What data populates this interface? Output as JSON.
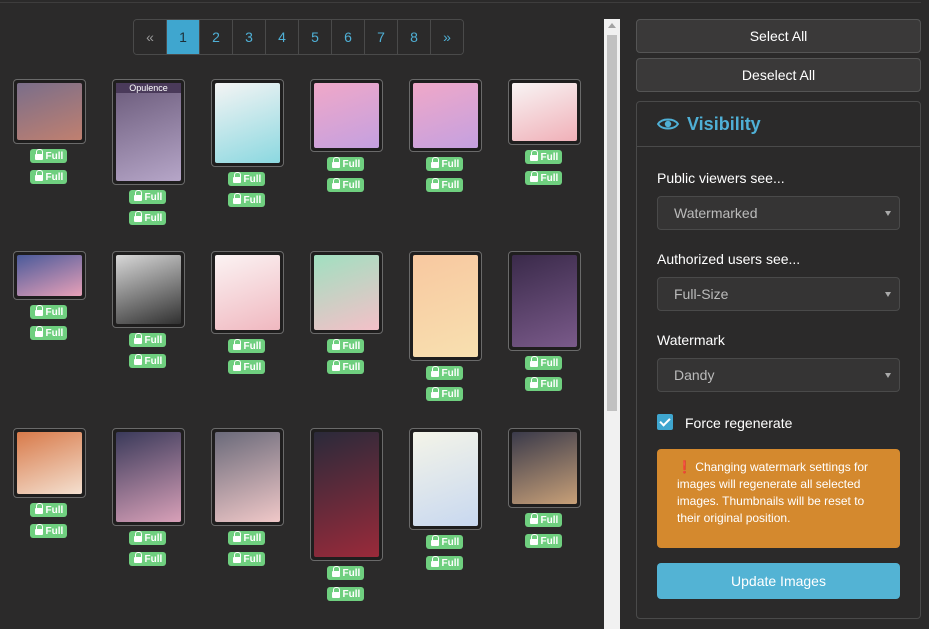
{
  "pagination": {
    "prev": "«",
    "pages": [
      "1",
      "2",
      "3",
      "4",
      "5",
      "6",
      "7",
      "8"
    ],
    "next": "»",
    "active": "1"
  },
  "gallery": {
    "thumbnails": [
      {
        "badges": [
          "Full",
          "Full"
        ],
        "colors": [
          "#7a6e8a",
          "#c08070"
        ]
      },
      {
        "badges": [
          "Full",
          "Full"
        ],
        "colors": [
          "#6a5a7a",
          "#b6a6c8"
        ],
        "title": "Opulence"
      },
      {
        "badges": [
          "Full",
          "Full"
        ],
        "colors": [
          "#f4f4f4",
          "#8bd8e0"
        ]
      },
      {
        "badges": [
          "Full",
          "Full"
        ],
        "colors": [
          "#f0a8c8",
          "#c4a0e0"
        ]
      },
      {
        "badges": [
          "Full",
          "Full"
        ],
        "colors": [
          "#f0a8c8",
          "#c4a0e0"
        ]
      },
      {
        "badges": [
          "Full",
          "Full"
        ],
        "colors": [
          "#f8f4f4",
          "#f0b0b8"
        ]
      },
      {
        "badges": [
          "Full",
          "Full"
        ],
        "colors": [
          "#4a5a9a",
          "#e8a0b8"
        ]
      },
      {
        "badges": [
          "Full",
          "Full"
        ],
        "colors": [
          "#d8d8d8",
          "#303030"
        ]
      },
      {
        "badges": [
          "Full",
          "Full"
        ],
        "colors": [
          "#fbf3f3",
          "#f0b8c0"
        ]
      },
      {
        "badges": [
          "Full",
          "Full"
        ],
        "colors": [
          "#a0e0c0",
          "#f4c0c8"
        ]
      },
      {
        "badges": [
          "Full",
          "Full"
        ],
        "colors": [
          "#f8c8a0",
          "#f8e0b0"
        ]
      },
      {
        "badges": [
          "Full",
          "Full"
        ],
        "colors": [
          "#3a2a4a",
          "#7a5a8a"
        ]
      },
      {
        "badges": [
          "Full",
          "Full"
        ],
        "colors": [
          "#d87a4a",
          "#f4e0d0"
        ]
      },
      {
        "badges": [
          "Full",
          "Full"
        ],
        "colors": [
          "#3a3a5a",
          "#d8a0b8"
        ]
      },
      {
        "badges": [
          "Full",
          "Full"
        ],
        "colors": [
          "#6a6a7a",
          "#f0c8c8"
        ]
      },
      {
        "badges": [
          "Full",
          "Full"
        ],
        "colors": [
          "#2a2a3a",
          "#9a2a3a"
        ]
      },
      {
        "badges": [
          "Full",
          "Full"
        ],
        "colors": [
          "#f4f4e8",
          "#c8d8f0"
        ]
      },
      {
        "badges": [
          "Full",
          "Full"
        ],
        "colors": [
          "#3a3a4a",
          "#c8a078"
        ]
      }
    ]
  },
  "sidebar": {
    "select_all": "Select All",
    "deselect_all": "Deselect All",
    "panel": {
      "title": "Visibility",
      "icon": "eye-icon",
      "public_label": "Public viewers see...",
      "public_value": "Watermarked",
      "authorized_label": "Authorized users see...",
      "authorized_value": "Full-Size",
      "watermark_label": "Watermark",
      "watermark_value": "Dandy",
      "force_label": "Force regenerate",
      "force_checked": true,
      "alert_text": "Changing watermark settings for images will regenerate all selected images. Thumbnails will be reset to their original position.",
      "update_button": "Update Images"
    }
  },
  "colors": {
    "accent": "#4fb0d6",
    "badge_green": "#6fcf7f",
    "alert_orange": "#d4892e",
    "update_blue": "#53b3d4"
  }
}
